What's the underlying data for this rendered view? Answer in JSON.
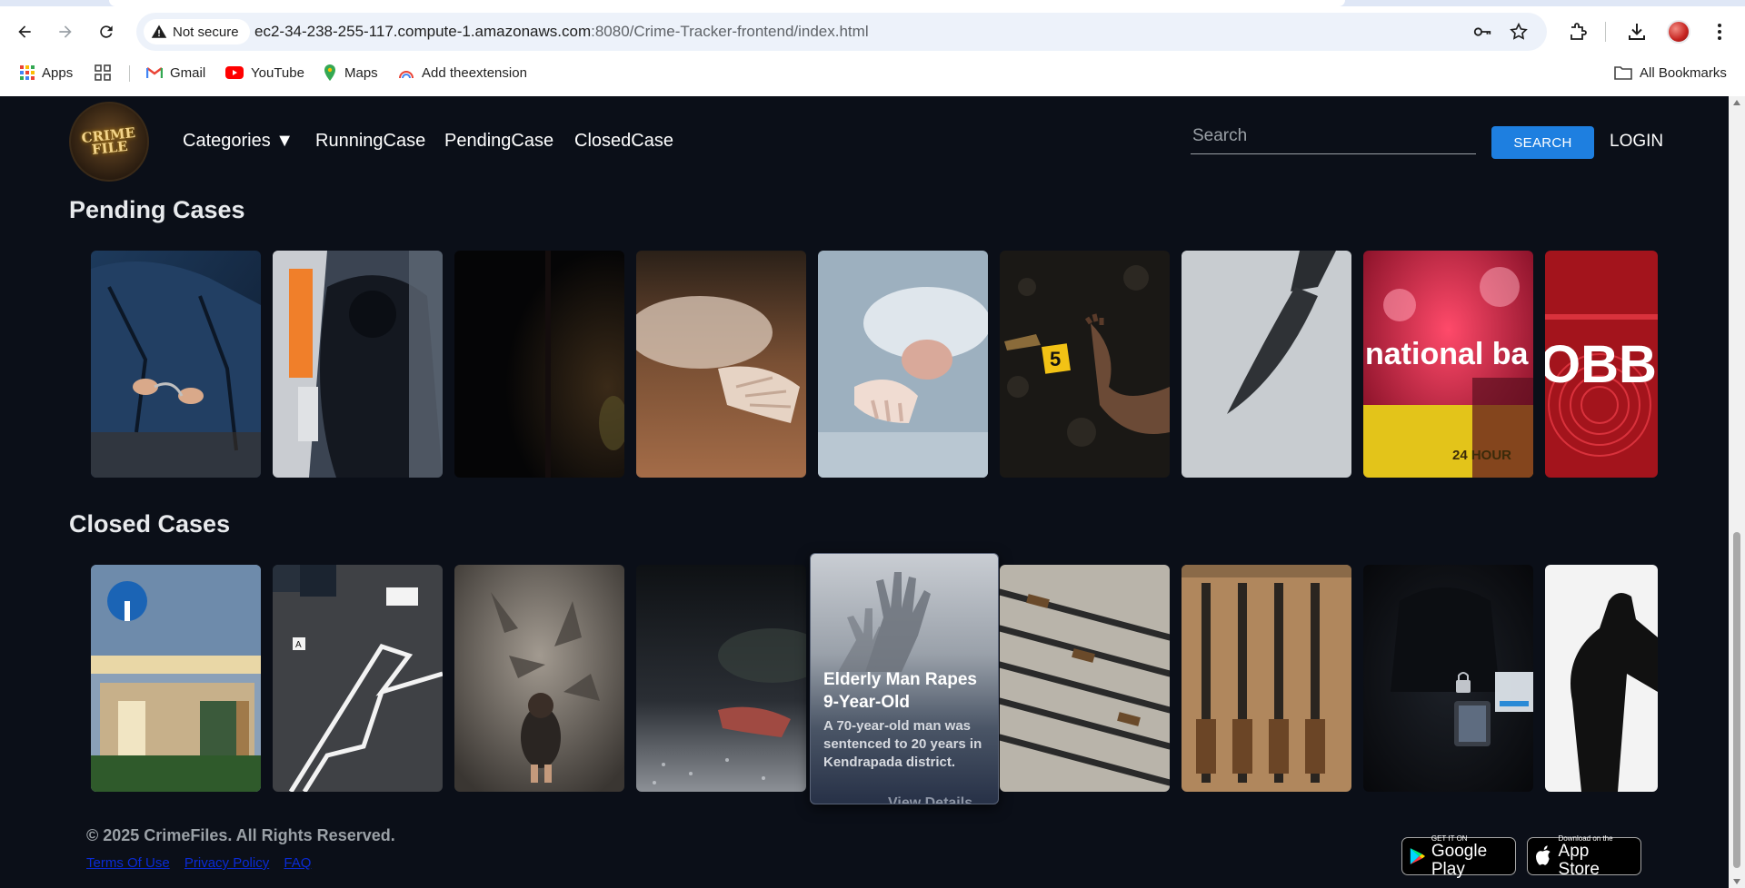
{
  "browser": {
    "security_label": "Not secure",
    "url_host": "ec2-34-238-255-117.compute-1.amazonaws.com",
    "url_rest": ":8080/Crime-Tracker-frontend/index.html",
    "bookmarks": [
      "Apps",
      "Gmail",
      "YouTube",
      "Maps",
      "Add theextension"
    ],
    "all_bookmarks": "All Bookmarks"
  },
  "site": {
    "logo_text": "CRIME FILE",
    "nav": {
      "categories": "Categories ▼",
      "running": "RunningCase",
      "pending": "PendingCase",
      "closed": "ClosedCase"
    },
    "search_placeholder": "Search",
    "search_button": "SEARCH",
    "login": "LOGIN"
  },
  "sections": {
    "pending_title": "Pending Cases",
    "closed_title": "Closed Cases"
  },
  "pending_cards": [
    {
      "image": "handcuffed-suspect-photo"
    },
    {
      "image": "atm-robbery-photo"
    },
    {
      "image": "dark-shadow-photo"
    },
    {
      "image": "lifeless-hand-photo"
    },
    {
      "image": "victim-on-floor-photo"
    },
    {
      "image": "crime-scene-evidence-marker-photo",
      "marker": "5"
    },
    {
      "image": "knife-shadow-photo"
    },
    {
      "image": "national-bank-atm-photo",
      "sign_text": "national ba",
      "sign_hours": "24 HOUR"
    },
    {
      "image": "robbery-fingerprint-photo",
      "overlay_text": "OBB"
    }
  ],
  "closed_cards": [
    {
      "image": "sbi-bank-branch-photo"
    },
    {
      "image": "chalk-outline-crime-scene-photo"
    },
    {
      "image": "child-with-shadow-hands-photo"
    },
    {
      "image": "hand-on-wet-ground-photo"
    },
    {
      "image": "featured-hover-card"
    },
    {
      "image": "seized-rifles-photo"
    },
    {
      "image": "rifles-on-wall-photo"
    },
    {
      "image": "hacker-phone-lock-photo"
    },
    {
      "image": "man-silhouette-photo"
    }
  ],
  "featured_card": {
    "title": "Elderly Man Rapes 9-Year-Old",
    "description": "A 70-year-old man was sentenced to 20 years in Kendrapada district.",
    "link": "View Details"
  },
  "footer": {
    "copyright": "© 2025 CrimeFiles. All Rights Reserved.",
    "links": [
      "Terms Of Use",
      "Privacy Policy",
      "FAQ"
    ],
    "google_small": "GET IT ON",
    "google_big": "Google Play",
    "apple_small": "Download on the",
    "apple_big": "App Store"
  }
}
